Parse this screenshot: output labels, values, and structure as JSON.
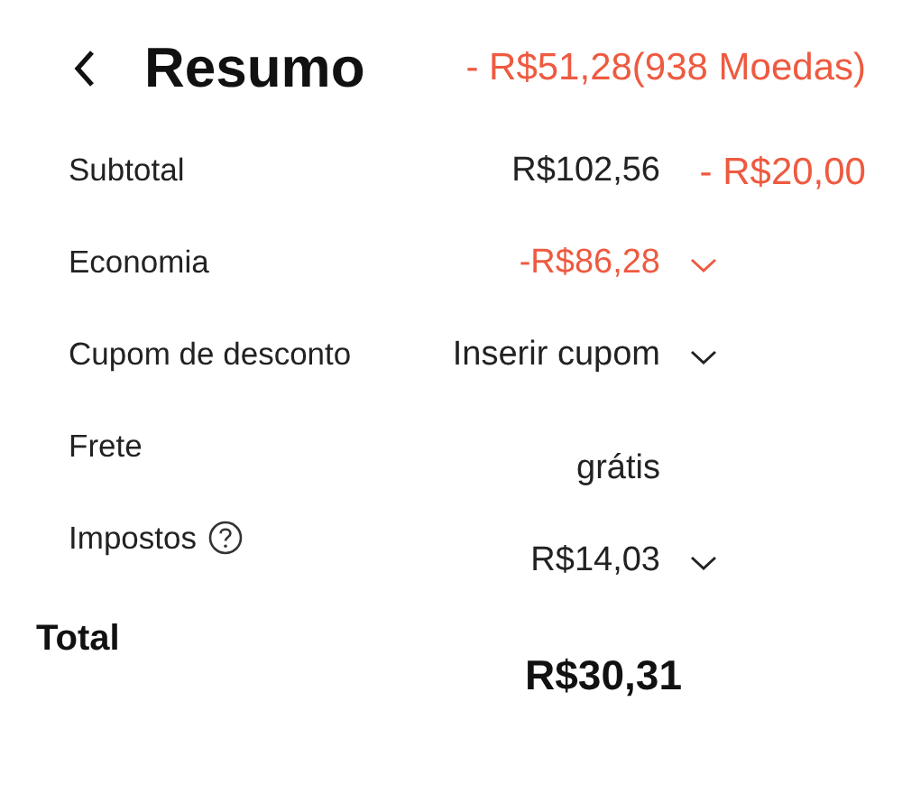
{
  "header": {
    "title": "Resumo",
    "coins_discount": "- R$51,28(938 Moedas)"
  },
  "rows": [
    {
      "kind": "split",
      "label": "Subtotal",
      "value": "R$102,56",
      "color": "#222222",
      "extra": "- R$20,00"
    },
    {
      "kind": "dropdown",
      "label": "Economia",
      "value": "-R$86,28",
      "color": "#ee5a40"
    },
    {
      "kind": "dropdown",
      "label": "Cupom de desconto",
      "value": "Inserir cupom",
      "color": "#222222"
    },
    {
      "kind": "plain",
      "label": "Frete",
      "value": "grátis",
      "color": "#222222"
    },
    {
      "kind": "help_dropdown",
      "label": "Impostos",
      "value": "R$14,03",
      "color": "#222222"
    }
  ],
  "total": {
    "label": "Total",
    "value": "R$30,31"
  }
}
